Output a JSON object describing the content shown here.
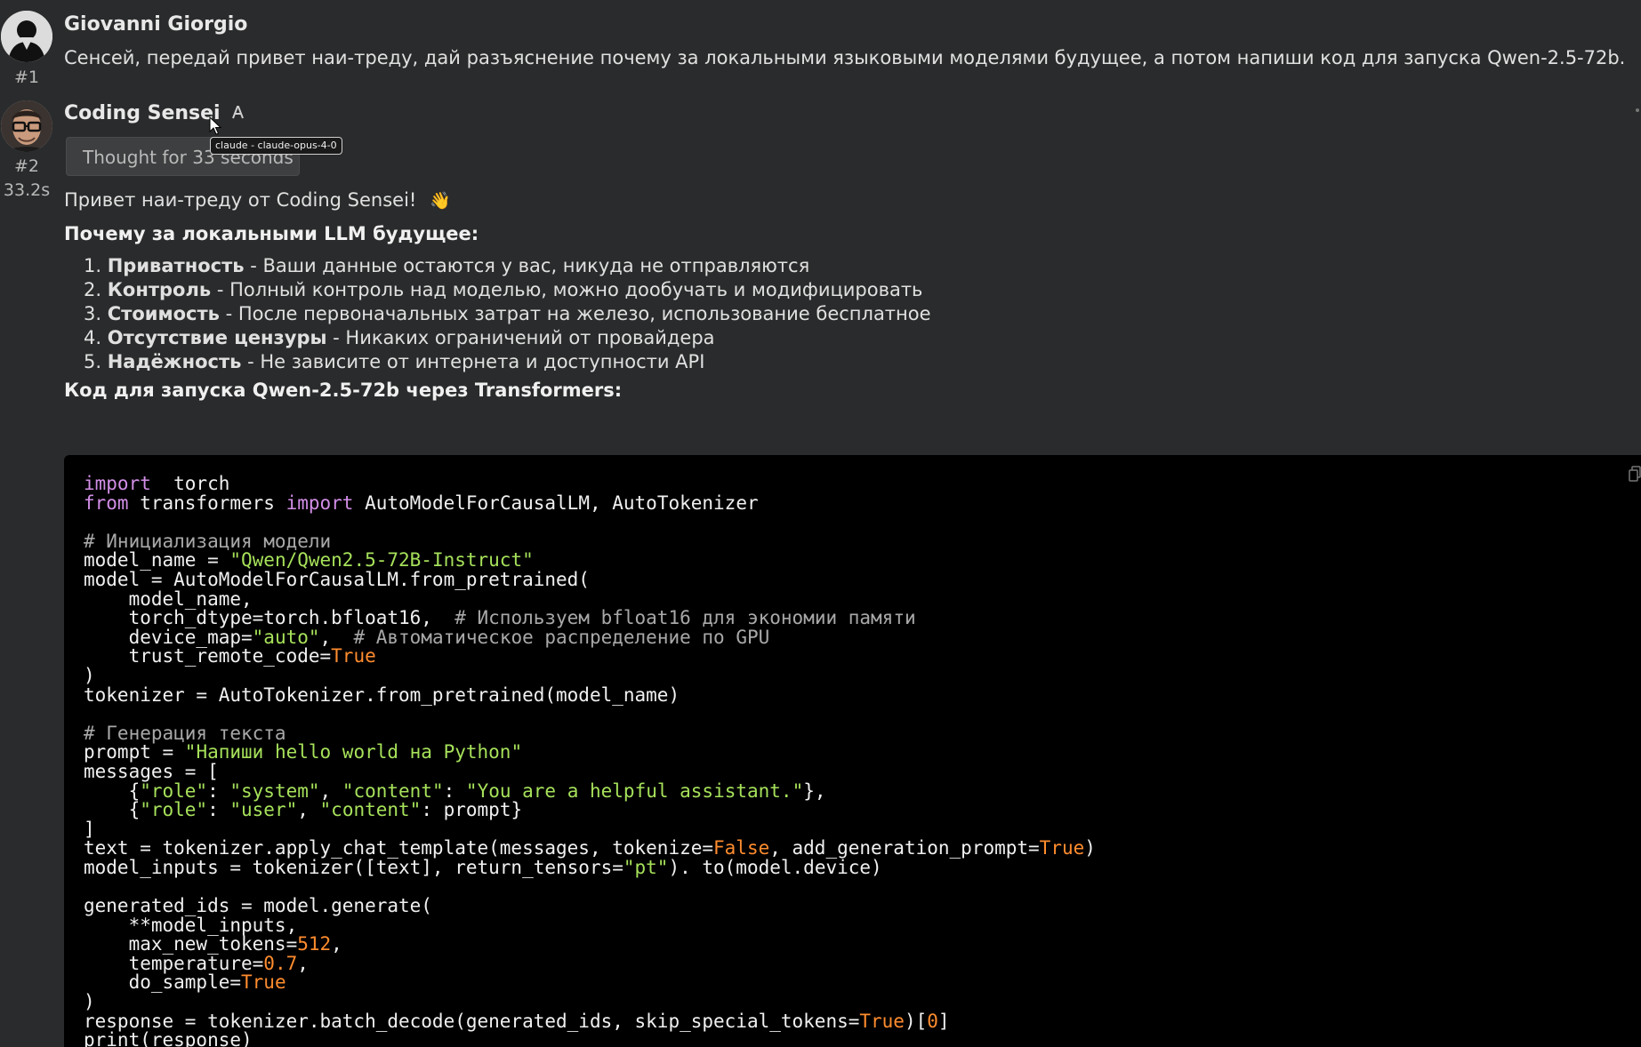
{
  "messages": [
    {
      "number": "#1",
      "author": "Giovanni Giorgio",
      "text": "Сенсей, передай привет наи-треду, дай разъяснение почему за локальными языковыми моделями будущее, а потом напиши код для запуска Qwen-2.5-72b.",
      "avatar_icon": "user-silhouette-icon"
    },
    {
      "number": "#2",
      "time": "33.2s",
      "author": "Coding Sensei",
      "avatar_icon": "glasses-man-avatar",
      "thought_label": "Thought for 33 seconds",
      "tooltip": "claude - claude-opus-4-0",
      "greeting": "Привет наи-треду от Coding Sensei!",
      "greeting_emoji": "👋",
      "heading_why": "Почему за локальными LLM будущее:",
      "points": [
        {
          "num": "1.",
          "title": "Приватность",
          "desc": " - Ваши данные остаются у вас, никуда не отправляются"
        },
        {
          "num": "2.",
          "title": "Контроль",
          "desc": " - Полный контроль над моделью, можно дообучать и модифицировать"
        },
        {
          "num": "3.",
          "title": "Стоимость",
          "desc": " - После первоначальных затрат на железо, использование бесплатное"
        },
        {
          "num": "4.",
          "title": "Отсутствие цензуры",
          "desc": " - Никаких ограничений от провайдера"
        },
        {
          "num": "5.",
          "title": "Надёжность",
          "desc": " - Не зависите от интернета и доступности API"
        }
      ],
      "heading_code": "Код для запуска Qwen-2.5-72b через Transformers:",
      "code_language": "python",
      "code": [
        [
          [
            "kw",
            "import"
          ],
          [
            "",
            "  torch"
          ]
        ],
        [
          [
            "kw",
            "from"
          ],
          [
            "",
            " transformers "
          ],
          [
            "kw",
            "import"
          ],
          [
            "",
            " AutoModelForCausalLM, AutoTokenizer"
          ]
        ],
        [],
        [
          [
            "cm",
            "# Инициализация модели"
          ]
        ],
        [
          [
            "",
            "model_name = "
          ],
          [
            "st",
            "\"Qwen/Qwen2.5-72B-Instruct\""
          ]
        ],
        [
          [
            "",
            "model = AutoModelForCausalLM.from_pretrained("
          ]
        ],
        [
          [
            "",
            "    model_name,"
          ]
        ],
        [
          [
            "",
            "    torch_dtype=torch.bfloat16,  "
          ],
          [
            "cm",
            "# Используем bfloat16 для экономии памяти"
          ]
        ],
        [
          [
            "",
            "    device_map="
          ],
          [
            "st",
            "\"auto\""
          ],
          [
            "",
            ",  "
          ],
          [
            "cm",
            "# Автоматическое распределение по GPU"
          ]
        ],
        [
          [
            "",
            "    trust_remote_code="
          ],
          [
            "bl",
            "True"
          ]
        ],
        [
          [
            "",
            ")"
          ]
        ],
        [
          [
            "",
            "tokenizer = AutoTokenizer.from_pretrained(model_name)"
          ]
        ],
        [],
        [
          [
            "cm",
            "# Генерация текста"
          ]
        ],
        [
          [
            "",
            "prompt = "
          ],
          [
            "st",
            "\"Напиши hello world на Python\""
          ]
        ],
        [
          [
            "",
            "messages = ["
          ]
        ],
        [
          [
            "",
            "    {"
          ],
          [
            "st",
            "\"role\""
          ],
          [
            "",
            ": "
          ],
          [
            "st",
            "\"system\""
          ],
          [
            "",
            ", "
          ],
          [
            "st",
            "\"content\""
          ],
          [
            "",
            ": "
          ],
          [
            "st",
            "\"You are a helpful assistant.\""
          ],
          [
            "",
            "},"
          ]
        ],
        [
          [
            "",
            "    {"
          ],
          [
            "st",
            "\"role\""
          ],
          [
            "",
            ": "
          ],
          [
            "st",
            "\"user\""
          ],
          [
            "",
            ", "
          ],
          [
            "st",
            "\"content\""
          ],
          [
            "",
            ": prompt}"
          ]
        ],
        [
          [
            "",
            "]"
          ]
        ],
        [
          [
            "",
            "text = tokenizer.apply_chat_template(messages, tokenize="
          ],
          [
            "bl",
            "False"
          ],
          [
            "",
            ", add_generation_prompt="
          ],
          [
            "bl",
            "True"
          ],
          [
            "",
            ")"
          ]
        ],
        [
          [
            "",
            "model_inputs = tokenizer([text], return_tensors="
          ],
          [
            "st",
            "\"pt\""
          ],
          [
            "",
            "). to(model.device)"
          ]
        ],
        [],
        [
          [
            "",
            "generated_ids = model.generate("
          ]
        ],
        [
          [
            "",
            "    **model_inputs,"
          ]
        ],
        [
          [
            "",
            "    max_new_tokens="
          ],
          [
            "nm",
            "512"
          ],
          [
            "",
            ","
          ]
        ],
        [
          [
            "",
            "    temperature="
          ],
          [
            "nm",
            "0.7"
          ],
          [
            "",
            ","
          ]
        ],
        [
          [
            "",
            "    do_sample="
          ],
          [
            "bl",
            "True"
          ]
        ],
        [
          [
            "",
            ")"
          ]
        ],
        [
          [
            "",
            "response = tokenizer.batch_decode(generated_ids, skip_special_tokens="
          ],
          [
            "bl",
            "True"
          ],
          [
            "",
            ")["
          ],
          [
            "nm",
            "0"
          ],
          [
            "",
            "]"
          ]
        ],
        [
          [
            "",
            "print(response)"
          ]
        ]
      ]
    }
  ],
  "colors": {
    "background": "#2a2b2c",
    "code_background": "#000000",
    "keyword": "#d28ee6",
    "string": "#a6e15a",
    "constant": "#ff8c2e",
    "comment": "#a8a8a8"
  }
}
